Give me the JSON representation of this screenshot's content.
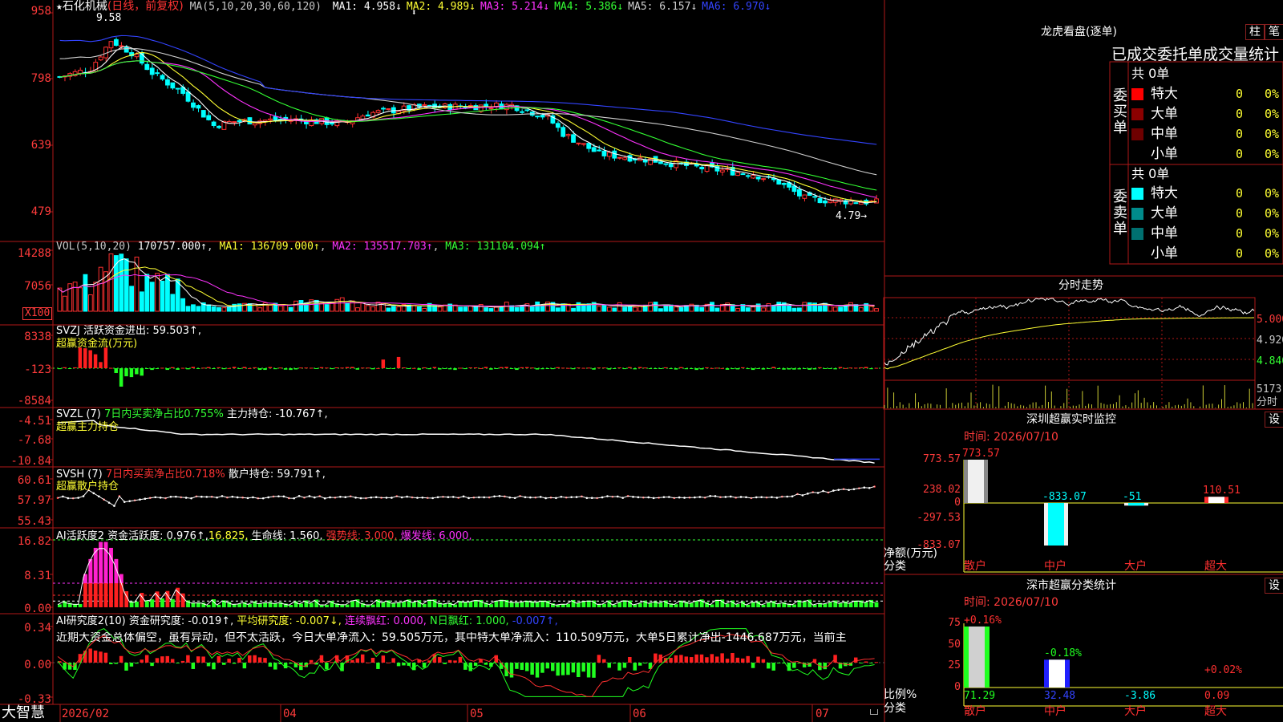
{
  "header": {
    "star": "★",
    "stock_name": "石化机械",
    "period": "(日线，前复权)",
    "ma_label": "MA(5,10,20,30,60,120)",
    "ma": [
      {
        "label": "MA1: 4.958↓",
        "color": "#ffffff"
      },
      {
        "label": "MA2: 4.989↓",
        "color": "#ffff33"
      },
      {
        "label": "MA3: 5.214↓",
        "color": "#ff33ff"
      },
      {
        "label": "MA4: 5.386↓",
        "color": "#33ff33"
      },
      {
        "label": "MA5: 6.157↓",
        "color": "#d0d0d0"
      },
      {
        "label": "MA6: 6.970↓",
        "color": "#3344ff"
      }
    ]
  },
  "price_panel": {
    "y_ticks": [
      "958",
      "798",
      "639",
      "479"
    ],
    "max_label": "9.58",
    "last_label": "4.79→"
  },
  "vol_panel": {
    "title": "VOL(5,10,20)",
    "val": "170757.000↑",
    "ma1": "MA1: 136709.000↑",
    "ma2": "MA2: 135517.703↑",
    "ma3": "MA3: 131104.094↑",
    "y_ticks": [
      "14288",
      "7056"
    ],
    "unit": "X100"
  },
  "svzj_panel": {
    "title": "SVZJ  活跃资金进出: 59.503↑,",
    "subtitle": "超赢资金流(万元)",
    "y_ticks": [
      "8338",
      "-123",
      "-8584"
    ]
  },
  "svzl_panel": {
    "name": "SVZL (7)",
    "ratio": "7日内买卖净占比0.755%",
    "hold": "主力持仓: -10.767↑,",
    "subtitle": "超赢主力持仓",
    "y_ticks": [
      "-4.51",
      "-7.68",
      "-10.84"
    ]
  },
  "svsh_panel": {
    "name": "SVSH (7)",
    "ratio": "7日内买卖净占比0.718%",
    "hold": "散户持仓: 59.791↑,",
    "subtitle": "超赢散户持仓",
    "y_ticks": [
      "60.61",
      "57.97",
      "55.43"
    ]
  },
  "ai1_panel": {
    "name": "AI活跃度2",
    "v1": "资金活跃度: 0.976↑,",
    "v2": "16.825,",
    "v3": "生命线: 1.560,",
    "v4": "强势线: 3.000,",
    "v5": "爆发线: 6.000,",
    "y_ticks": [
      "16.82",
      "8.31",
      "0.00"
    ]
  },
  "ai2_panel": {
    "name": "AI研究度2(10)",
    "v1": "资金研究度: -0.019↑,",
    "v2": "平均研究度: -0.007↓,",
    "v3": "连续飘红: 0.000,",
    "v4": "N日飘红: 1.000,",
    "v5": "-0.007↑,",
    "desc": "近期大资金总体偏空，虽有异动，但不太活跃，今日大单净流入：59.505万元，其中特大单净流入：110.509万元，大单5日累计净出-1446.687万元，当前主",
    "y_ticks": [
      "0.34",
      "0.00",
      "-0.33"
    ]
  },
  "x_axis": {
    "brand": "大智慧",
    "labels": [
      "2026/02",
      "04",
      "05",
      "06",
      "07"
    ]
  },
  "longhu": {
    "title": "龙虎看盘(逐单)",
    "btn_bar": "柱",
    "btn_pen": "笔",
    "header": "已成交委托单成交量统计",
    "buy_label": "委买单",
    "sell_label": "委卖单",
    "buy_total": "共 0单",
    "sell_total": "共 0单",
    "buy_rows": [
      {
        "name": "特大",
        "count": "0",
        "pct": "0%",
        "color": "#ff0000"
      },
      {
        "name": "大单",
        "count": "0",
        "pct": "0%",
        "color": "#8b0000"
      },
      {
        "name": "中单",
        "count": "0",
        "pct": "0%",
        "color": "#6e0000"
      },
      {
        "name": "小单",
        "count": "0",
        "pct": "0%",
        "color": ""
      }
    ],
    "sell_rows": [
      {
        "name": "特大",
        "count": "0",
        "pct": "0%",
        "color": "#00ffff"
      },
      {
        "name": "大单",
        "count": "0",
        "pct": "0%",
        "color": "#008b8b"
      },
      {
        "name": "中单",
        "count": "0",
        "pct": "0%",
        "color": "#007070"
      },
      {
        "name": "小单",
        "count": "0",
        "pct": "0%",
        "color": ""
      }
    ]
  },
  "intraday": {
    "title": "分时走势",
    "y_ticks": [
      "5.000",
      "4.920",
      "4.840"
    ],
    "vol_tick": "5173",
    "vol_unit": "分时"
  },
  "sz_monitor": {
    "title": "深圳超赢实时监控",
    "setting": "设",
    "time": "时间: 2026/07/10",
    "y_ticks": [
      "773.57",
      "238.02",
      "0",
      "-297.53",
      "-833.07"
    ],
    "net_label": "净额(万元)",
    "cat_label": "分类",
    "categories": [
      "散户",
      "中户",
      "大户",
      "超大"
    ],
    "values": [
      773.57,
      -833.07,
      -51,
      110.51
    ],
    "value_labels": [
      "773.57",
      "-833.07",
      "-51",
      "110.51"
    ]
  },
  "sz_stats": {
    "title": "深市超赢分类统计",
    "setting": "设",
    "time": "时间: 2026/07/10",
    "y_ticks": [
      "75",
      "50",
      "25",
      "0"
    ],
    "ratio_label": "比例%",
    "cat_label": "分类",
    "categories": [
      "散户",
      "中户",
      "大户",
      "超大"
    ],
    "values": [
      71.29,
      32.48,
      -3.86,
      0.09
    ],
    "top_labels": [
      "+0.16%",
      "-0.18%",
      "",
      "+0.02%"
    ],
    "bottom_labels": [
      "71.29",
      "32.48",
      "-3.86",
      "0.09"
    ]
  },
  "chart_data": [
    {
      "type": "bar",
      "title": "深圳超赢实时监控",
      "ylabel": "净额(万元)",
      "xlabel": "分类",
      "categories": [
        "散户",
        "中户",
        "大户",
        "超大"
      ],
      "values": [
        773.57,
        -833.07,
        -51,
        110.51
      ],
      "ylim": [
        -833.07,
        773.57
      ]
    },
    {
      "type": "bar",
      "title": "深市超赢分类统计",
      "ylabel": "比例%",
      "xlabel": "分类",
      "categories": [
        "散户",
        "中户",
        "大户",
        "超大"
      ],
      "values": [
        71.29,
        32.48,
        -3.86,
        0.09
      ],
      "ylim": [
        0,
        75
      ]
    },
    {
      "type": "line",
      "title": "石化机械",
      "ylabel": "",
      "x": [
        "2026/02",
        "04",
        "05",
        "06",
        "07"
      ],
      "series": [
        {
          "name": "MA1",
          "values": [
            8.6,
            7.0,
            7.2,
            5.9,
            4.958
          ]
        },
        {
          "name": "MA6",
          "values": [
            7.7,
            7.6,
            7.5,
            7.3,
            6.97
          ]
        }
      ],
      "ylim": [
        4.79,
        9.58
      ]
    }
  ]
}
